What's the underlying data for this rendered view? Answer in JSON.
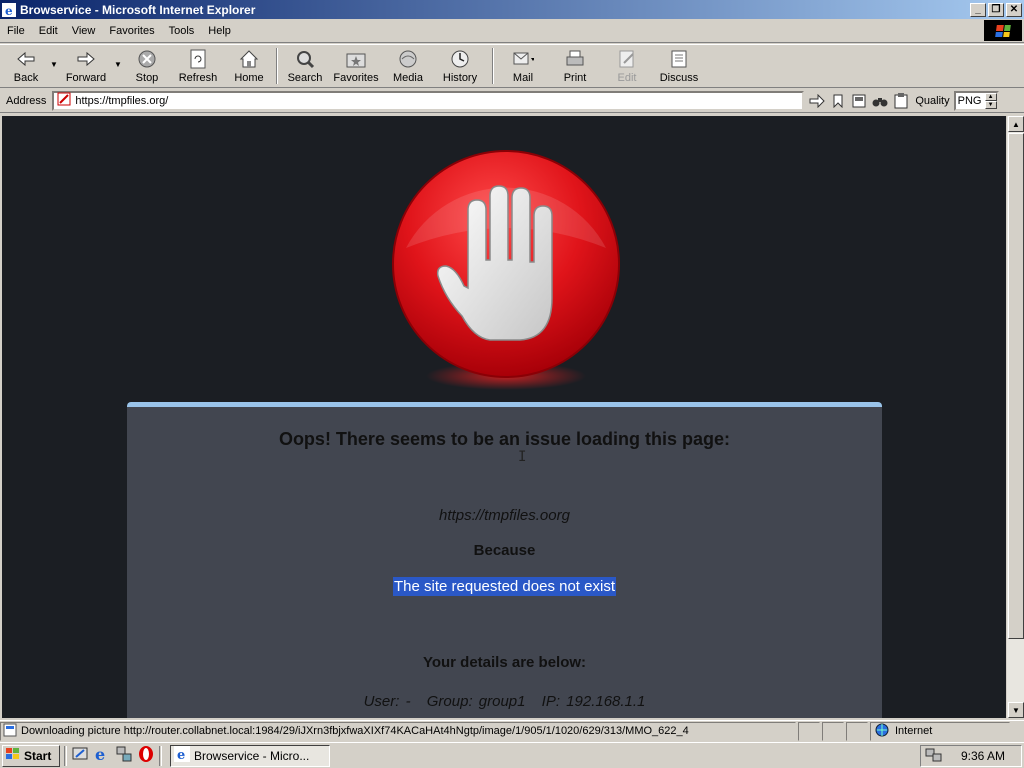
{
  "window": {
    "title": "Browservice - Microsoft Internet Explorer"
  },
  "menu": [
    {
      "label": "File"
    },
    {
      "label": "Edit"
    },
    {
      "label": "View"
    },
    {
      "label": "Favorites"
    },
    {
      "label": "Tools"
    },
    {
      "label": "Help"
    }
  ],
  "toolbar": {
    "back": "Back",
    "forward": "Forward",
    "stop": "Stop",
    "refresh": "Refresh",
    "home": "Home",
    "search": "Search",
    "favorites": "Favorites",
    "media": "Media",
    "history": "History",
    "mail": "Mail",
    "print": "Print",
    "edit": "Edit",
    "discuss": "Discuss"
  },
  "address": {
    "label": "Address",
    "url": "https://tmpfiles.org/"
  },
  "quality": {
    "label": "Quality",
    "value": "PNG"
  },
  "page": {
    "title": "Oops! There seems to be an issue loading this page:",
    "url": "https://tmpfiles.oorg",
    "because": "Because",
    "reason": "The site requested does not exist",
    "details_heading": "Your details are below:",
    "user": "User: -",
    "group": "Group: group1",
    "ip": "IP: 192.168.1.1"
  },
  "status": {
    "text": "Downloading picture http://router.collabnet.local:1984/29/iJXrn3fbjxfwaXIXf74KACaHAt4hNgtp/image/1/905/1/1020/629/313/MMO_622_4",
    "zone": "Internet"
  },
  "taskbar": {
    "start": "Start",
    "task": "Browservice - Micro...",
    "time": "9:36 AM"
  },
  "colors": {
    "titlebar": "#0a246a",
    "page_bg": "#1b1e23",
    "card_bg": "#424650",
    "card_border": "#9ac4ea",
    "selection": "#2a58c7",
    "stop_red": "#e0141a"
  }
}
